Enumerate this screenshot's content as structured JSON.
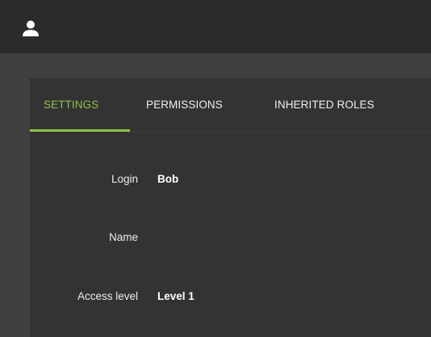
{
  "header": {
    "user_icon": "user-icon"
  },
  "tabs": [
    {
      "label": "SETTINGS",
      "active": true
    },
    {
      "label": "PERMISSIONS",
      "active": false
    },
    {
      "label": "INHERITED ROLES",
      "active": false
    }
  ],
  "form": {
    "login": {
      "label": "Login",
      "value": "Bob"
    },
    "name": {
      "label": "Name",
      "value": ""
    },
    "access_level": {
      "label": "Access level",
      "value": "Level 1"
    }
  },
  "colors": {
    "accent": "#8bc34a",
    "topbar": "#2b2b2b",
    "background": "#404040",
    "panel": "#333333"
  }
}
